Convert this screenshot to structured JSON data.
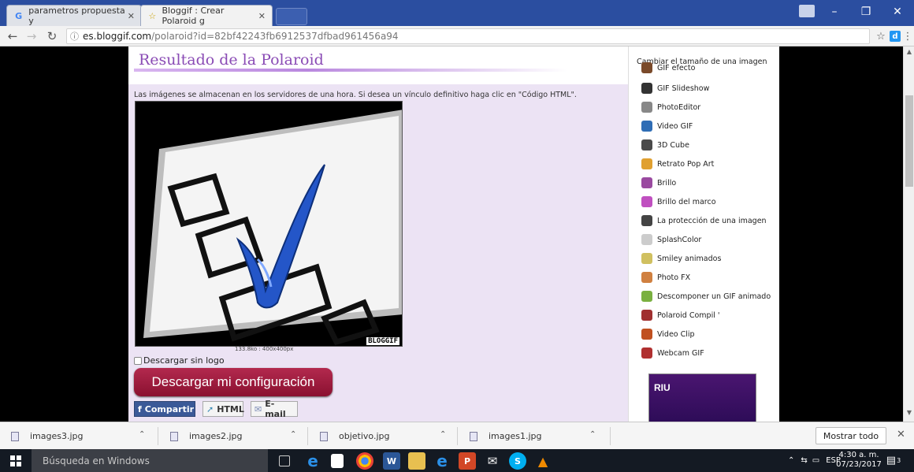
{
  "browser": {
    "tabs": [
      {
        "label": "parametros propuesta y",
        "icon": "google-icon"
      },
      {
        "label": "Bloggif : Crear Polaroid g",
        "icon": "star-icon"
      }
    ],
    "address": {
      "host": "es.bloggif.com",
      "path": "/polaroid?id=82bf42243fb6912537dfbad961456a94"
    }
  },
  "page": {
    "title": "Resultado de la Polaroid",
    "info": "Las imágenes se almacenan en los servidores de una hora. Si desea un vínculo definitivo haga clic en \"Código HTML\".",
    "image_meta": "133.8ko  :  400x400px",
    "watermark": "BLOGGIF",
    "no_logo_label": "Descargar sin logo",
    "download_button": "Descargar mi configuración",
    "share": {
      "facebook": "Compartir",
      "html": "HTML",
      "email": "E-mail"
    }
  },
  "sidebar": {
    "top_label": "Cambiar el tamaño de una imagen",
    "items": [
      {
        "label": "GIF efecto",
        "color": "#7a4a2a"
      },
      {
        "label": "GIF Slideshow",
        "color": "#333333"
      },
      {
        "label": "PhotoEditor",
        "color": "#888888"
      },
      {
        "label": "Video GIF",
        "color": "#2f6db5"
      },
      {
        "label": "3D Cube",
        "color": "#4a4a4a"
      },
      {
        "label": "Retrato Pop Art",
        "color": "#e0a030"
      },
      {
        "label": "Brillo",
        "color": "#9a4aa0"
      },
      {
        "label": "Brillo del marco",
        "color": "#c050c0"
      },
      {
        "label": "La protección de una imagen",
        "color": "#444444"
      },
      {
        "label": "SplashColor",
        "color": "#cccccc"
      },
      {
        "label": "Smiley animados",
        "color": "#d0c060"
      },
      {
        "label": "Photo FX",
        "color": "#d08040"
      },
      {
        "label": "Descomponer un GIF animado",
        "color": "#7ab040"
      },
      {
        "label": "Polaroid Compil '",
        "color": "#a03030"
      },
      {
        "label": "Video Clip",
        "color": "#c05020"
      },
      {
        "label": "Webcam GIF",
        "color": "#b03030"
      }
    ],
    "ad_text": "RIU"
  },
  "downloads": {
    "items": [
      "images3.jpg",
      "images2.jpg",
      "objetivo.jpg",
      "images1.jpg"
    ],
    "show_all": "Mostrar todo"
  },
  "taskbar": {
    "search_placeholder": "Búsqueda en Windows",
    "lang": "ESP",
    "time": "4:30 a. m.",
    "date": "07/23/2017",
    "notif_count": "3"
  }
}
